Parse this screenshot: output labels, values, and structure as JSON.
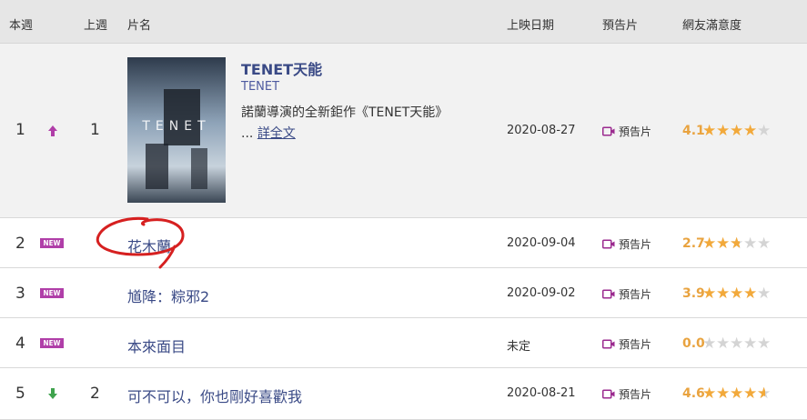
{
  "header": {
    "this_week": "本週",
    "last_week": "上週",
    "title": "片名",
    "release_date": "上映日期",
    "trailer": "預告片",
    "rating": "網友滿意度"
  },
  "new_badge": "NEW",
  "trailer_label": "預告片",
  "rows": [
    {
      "rank": "1",
      "trend": "up",
      "prev": "1",
      "title": "TENET天能",
      "english_title": "TENET",
      "description": "諾蘭導演的全新鉅作《TENET天能》",
      "ellipsis": "...",
      "more_link": "詳全文",
      "date": "2020-08-27",
      "score": "4.1",
      "stars": 4.1,
      "poster_text": "TENET"
    },
    {
      "rank": "2",
      "trend": "new",
      "prev": "",
      "title": "花木蘭",
      "date": "2020-09-04",
      "score": "2.7",
      "stars": 2.7
    },
    {
      "rank": "3",
      "trend": "new",
      "prev": "",
      "title": "馗降：粽邪2",
      "date": "2020-09-02",
      "score": "3.9",
      "stars": 3.9
    },
    {
      "rank": "4",
      "trend": "new",
      "prev": "",
      "title": "本來面目",
      "date": "未定",
      "score": "0.0",
      "stars": 0
    },
    {
      "rank": "5",
      "trend": "down",
      "prev": "2",
      "title": "可不可以，你也剛好喜歡我",
      "date": "2020-08-21",
      "score": "4.6",
      "stars": 4.6
    }
  ],
  "colors": {
    "header_bg": "#e6e6e6",
    "title_blue": "#3a4a86",
    "star_gold": "#f2a93b",
    "score_gold": "#e9a33f",
    "badge_purple": "#b03ea8",
    "up_arrow": "#b03ea8",
    "down_arrow": "#3fa34d",
    "annotation_red": "#d62020"
  }
}
